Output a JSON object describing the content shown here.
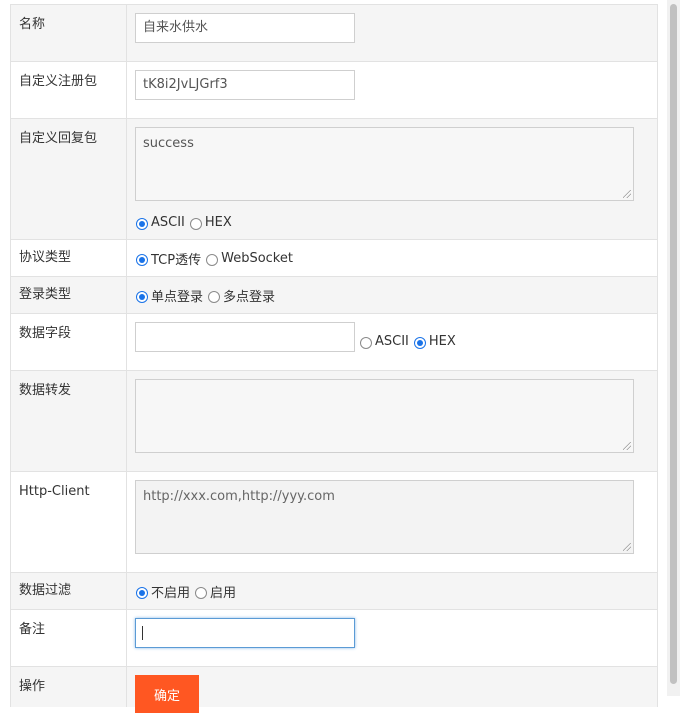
{
  "form": {
    "name": {
      "label": "名称",
      "value": "自来水供水"
    },
    "register_packet": {
      "label": "自定义注册包",
      "value": "tK8i2JvLJGrf3"
    },
    "reply_packet": {
      "label": "自定义回复包",
      "value": "success",
      "options": [
        "ASCII",
        "HEX"
      ],
      "selected": "ASCII"
    },
    "protocol": {
      "label": "协议类型",
      "options": [
        "TCP透传",
        "WebSocket"
      ],
      "selected": "TCP透传"
    },
    "login_type": {
      "label": "登录类型",
      "options": [
        "单点登录",
        "多点登录"
      ],
      "selected": "单点登录"
    },
    "data_field": {
      "label": "数据字段",
      "value": "",
      "options": [
        "ASCII",
        "HEX"
      ],
      "selected": "HEX"
    },
    "data_forward": {
      "label": "数据转发",
      "value": ""
    },
    "http_client": {
      "label": "Http-Client",
      "placeholder": "http://xxx.com,http://yyy.com"
    },
    "data_filter": {
      "label": "数据过滤",
      "options": [
        "不启用",
        "启用"
      ],
      "selected": "不启用"
    },
    "remark": {
      "label": "备注",
      "value": ""
    },
    "action": {
      "label": "操作",
      "submit_label": "确定"
    }
  },
  "colors": {
    "button": "#ff5722",
    "radio_selected": "#1a73e8",
    "row_alt": "#f5f5f5"
  }
}
